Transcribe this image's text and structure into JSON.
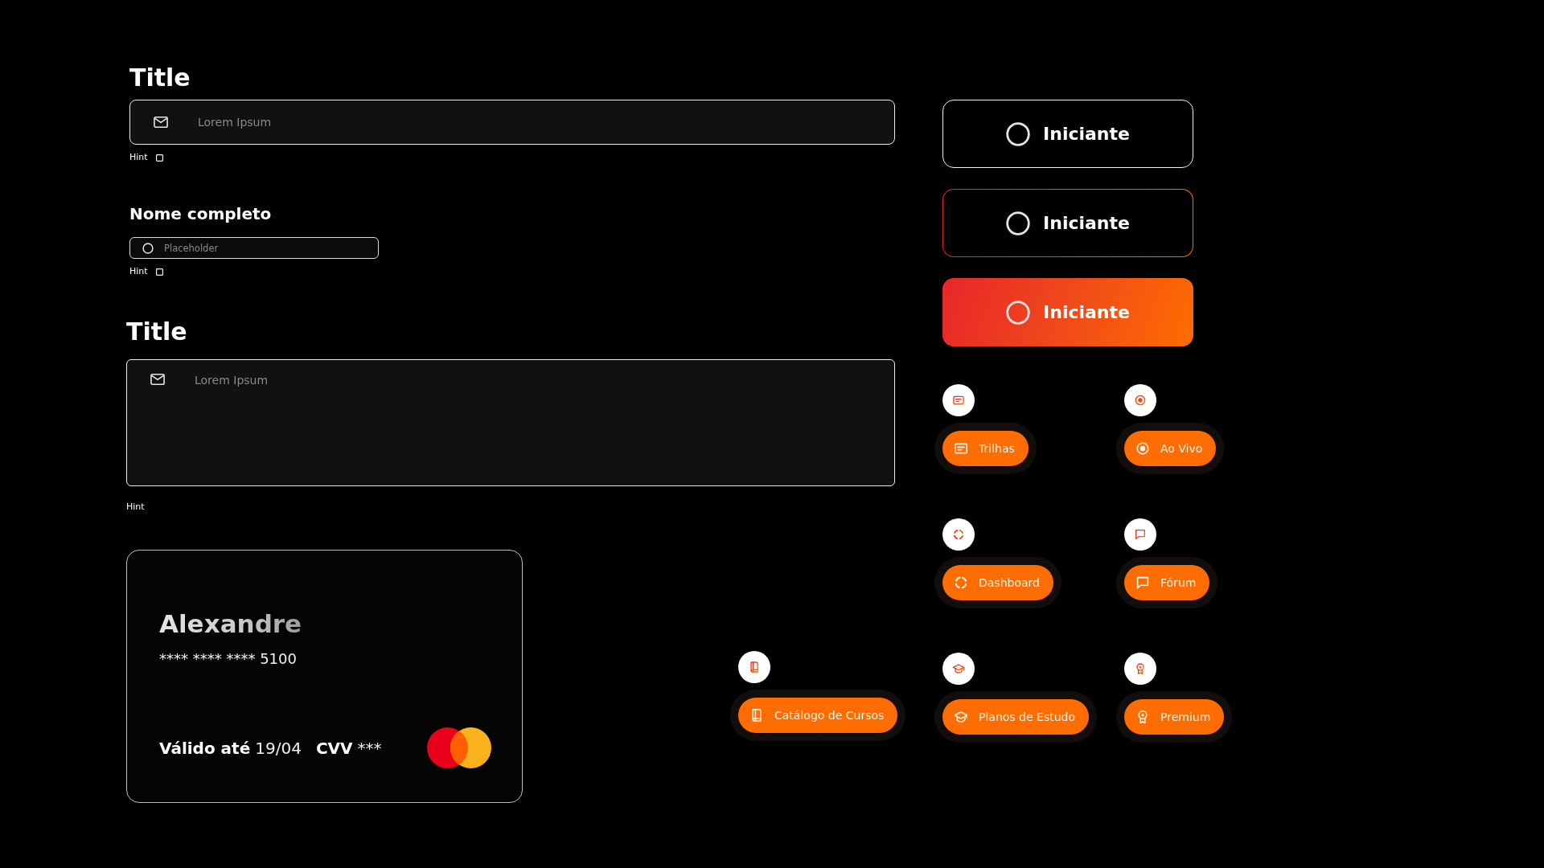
{
  "fields": [
    {
      "kind": "input",
      "title": "Title",
      "placeholder": "Lorem Ipsum",
      "hint": "Hint"
    },
    {
      "kind": "compact",
      "title": "Nome completo",
      "placeholder": "Placeholder",
      "hint": "Hint"
    },
    {
      "kind": "textarea",
      "title": "Title",
      "placeholder": "Lorem Ipsum",
      "hint": "Hint"
    }
  ],
  "card": {
    "holder": "Alexandre",
    "number": "**** **** **** 5100",
    "expiry_label": "Válido até",
    "expiry": "19/04",
    "cvv_label": "CVV",
    "cvv": "***"
  },
  "level_buttons": [
    {
      "kind": "outline",
      "label": "Iniciante"
    },
    {
      "kind": "bordered",
      "label": "Iniciante"
    },
    {
      "kind": "filled",
      "label": "Iniciante"
    }
  ],
  "chips": [
    {
      "kind": "panel",
      "label": "Trilhas"
    },
    {
      "kind": "record",
      "label": "Ao Vivo"
    },
    {
      "kind": "ring",
      "label": "Dashboard"
    },
    {
      "kind": "chat",
      "label": "Fórum"
    },
    {
      "kind": "book",
      "label": "Catálogo de Cursos"
    },
    {
      "kind": "cap",
      "label": "Planos de Estudo"
    },
    {
      "kind": "medal",
      "label": "Premium"
    }
  ]
}
